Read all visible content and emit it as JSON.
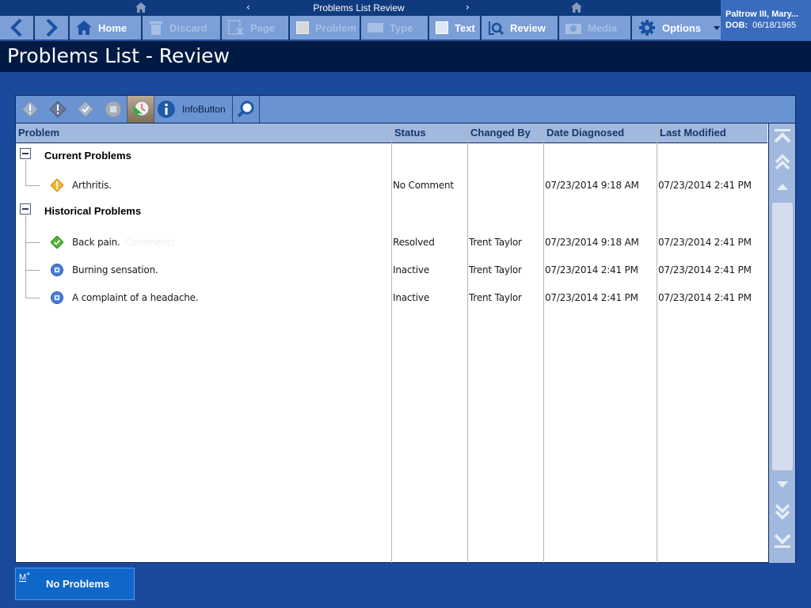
{
  "nav": {
    "breadcrumb_title": "Problems List Review",
    "prev_glyph": "‹",
    "next_glyph": "›",
    "icons": [
      "home-icon",
      "chevron-left-icon",
      "chevron-right-icon",
      "home-icon"
    ]
  },
  "toolbar": {
    "back_icon": "chevron-left-icon",
    "forward_icon": "chevron-right-icon",
    "buttons": [
      {
        "label": "Home",
        "icon": "home-icon",
        "enabled": true
      },
      {
        "label": "Discard",
        "icon": "trash-icon",
        "enabled": false
      },
      {
        "label": "Page",
        "icon": "page-x-icon",
        "enabled": false
      },
      {
        "label": "Problem",
        "icon": "checkbox-icon",
        "enabled": false
      },
      {
        "label": "Type",
        "icon": "keyboard-icon",
        "enabled": false
      },
      {
        "label": "Text",
        "icon": "checkbox-icon",
        "enabled": true
      },
      {
        "label": "Review",
        "icon": "review-search-icon",
        "enabled": true
      },
      {
        "label": "Media",
        "icon": "camera-icon",
        "enabled": false
      },
      {
        "label": "Options",
        "icon": "gear-icon",
        "enabled": true
      }
    ]
  },
  "patient": {
    "name": "Paltrow III, Mary...",
    "dob_label": "DOB:",
    "dob": "06/18/1965"
  },
  "page_title": "Problems List - Review",
  "panel_toolbar": {
    "filters": [
      "diamond-outline-icon",
      "warning-diamond-icon",
      "check-diamond-icon",
      "inactive-circle-icon",
      "history-clock-icon"
    ],
    "info_label": "InfoButton",
    "search_icon": "magnifier-icon"
  },
  "table": {
    "columns": [
      "Problem",
      "Status",
      "Changed By",
      "Date Diagnosed",
      "Last Modified"
    ],
    "groups": [
      {
        "title": "Current Problems",
        "rows": [
          {
            "icon": "warning",
            "problem": "Arthritis.",
            "status": "No Comment",
            "changed_by": "",
            "date_diagnosed": "07/23/2014 9:18 AM",
            "last_modified": "07/23/2014 2:41 PM"
          }
        ]
      },
      {
        "title": "Historical Problems",
        "rows": [
          {
            "icon": "resolved",
            "problem": "Back pain.",
            "status": "Resolved",
            "changed_by": "Trent Taylor",
            "date_diagnosed": "07/23/2014 9:18 AM",
            "last_modified": "07/23/2014 2:41 PM"
          },
          {
            "icon": "inactive",
            "problem": "Burning sensation.",
            "status": "Inactive",
            "changed_by": "Trent Taylor",
            "date_diagnosed": "07/23/2014 2:41 PM",
            "last_modified": "07/23/2014 2:41 PM"
          },
          {
            "icon": "inactive",
            "problem": "A complaint of a headache.",
            "status": "Inactive",
            "changed_by": "Trent Taylor",
            "date_diagnosed": "07/23/2014 2:41 PM",
            "last_modified": "07/23/2014 2:41 PM"
          }
        ]
      }
    ],
    "ghost_comment": "Comments"
  },
  "scrollbar": {
    "buttons": [
      "scroll-top-icon",
      "page-up-icon",
      "line-up-icon",
      "line-down-icon",
      "page-down-icon",
      "scroll-bottom-icon"
    ]
  },
  "footer": {
    "mic_label": "M",
    "mic_plus": "+",
    "no_problems_label": "No Problems"
  },
  "colors": {
    "nav_bg": "#0f3b7e",
    "toolbar_btn": "#7b9fd6",
    "page_bg": "#1b4a9c",
    "title_bar": "#001a44",
    "header_row": "#a2b9df",
    "patient_bg": "#3a6bbd",
    "no_problems_btn": "#0f67c8"
  }
}
